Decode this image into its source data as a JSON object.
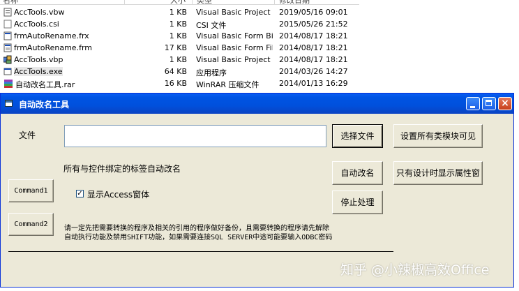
{
  "filelist": {
    "headers": {
      "name": "名称",
      "size": "大小",
      "type": "类型",
      "date": "修改日期"
    },
    "rows": [
      {
        "name": "AccTools.vbw",
        "size": "1 KB",
        "type": "Visual Basic Project ...",
        "date": "2019/05/16 09:01",
        "icon": "vb-workspace-icon"
      },
      {
        "name": "AccTools.csi",
        "size": "1 KB",
        "type": "CSI 文件",
        "date": "2015/05/26 21:52",
        "icon": "file-icon"
      },
      {
        "name": "frmAutoRename.frx",
        "size": "1 KB",
        "type": "Visual Basic Form Bi...",
        "date": "2014/08/17 18:21",
        "icon": "vb-form-binary-icon"
      },
      {
        "name": "frmAutoRename.frm",
        "size": "17 KB",
        "type": "Visual Basic Form File",
        "date": "2014/08/17 18:21",
        "icon": "vb-form-icon"
      },
      {
        "name": "AccTools.vbp",
        "size": "1 KB",
        "type": "Visual Basic Project",
        "date": "2014/08/17 18:21",
        "icon": "vb-project-icon"
      },
      {
        "name": "AccTools.exe",
        "size": "64 KB",
        "type": "应用程序",
        "date": "2014/03/26 14:27",
        "icon": "exe-icon"
      },
      {
        "name": "自动改名工具.rar",
        "size": "16 KB",
        "type": "WinRAR 压缩文件",
        "date": "2014/01/13 16:29",
        "icon": "rar-archive-icon"
      }
    ]
  },
  "window": {
    "title": "自动改名工具",
    "controls": {
      "minimize": "minimize",
      "maximize": "maximize",
      "close": "×"
    }
  },
  "form": {
    "file_label": "文件",
    "file_value": "",
    "choose_file_button": "选择文件",
    "set_class_visible_button": "设置所有类模块可见",
    "bound_label_rename_text": "所有与控件绑定的标签自动改名",
    "auto_rename_button": "自动改名",
    "show_props_design_button": "只有设计时显示属性窗",
    "command1_button": "Command1",
    "show_access_checkbox": {
      "label": "显示Access窗体",
      "checked": true,
      "mark": "✓"
    },
    "stop_button": "停止处理",
    "command2_button": "Command2",
    "notice_line1": "请一定先把需要转换的程序及相关的引用的程序做好备份，且需要转换的程序请先解除",
    "notice_line2": "自动执行功能及禁用SHIFT功能，如果需要连接SQL SERVER中途可能要输入ODBC密码"
  },
  "watermark": "知乎 @小辣椒高效Office",
  "colors": {
    "titlebar": "#0054e3",
    "dialog_bg": "#ece9d8",
    "close_button": "#c7401c"
  }
}
